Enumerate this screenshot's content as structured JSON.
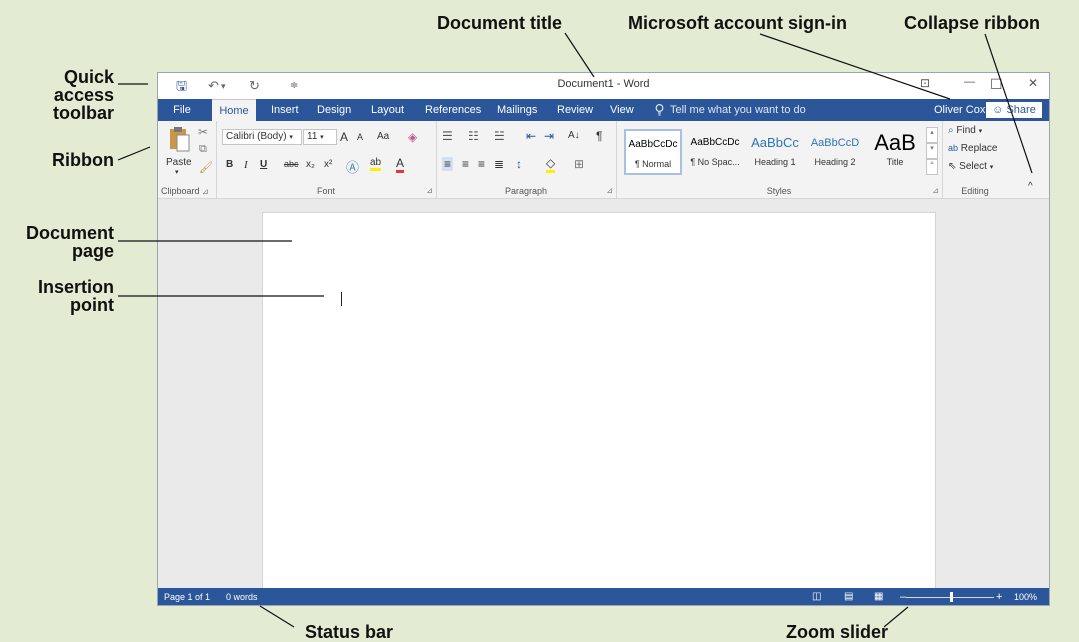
{
  "callouts": {
    "document_title": "Document title",
    "account_signin": "Microsoft account sign-in",
    "collapse_ribbon": "Collapse ribbon",
    "qat_1": "Quick",
    "qat_2": "access",
    "qat_3": "toolbar",
    "ribbon": "Ribbon",
    "doc_page_1": "Document",
    "doc_page_2": "page",
    "insertion_1": "Insertion",
    "insertion_2": "point",
    "status_bar": "Status bar",
    "zoom_slider": "Zoom slider"
  },
  "window": {
    "title": "Document1 - Word",
    "qat": {
      "save": "🖫",
      "undo": "↶",
      "undo_drop": "▾",
      "redo": "↻",
      "customize": "≑"
    },
    "controls": {
      "ribbon_options": "⊡",
      "minimize": "—",
      "maximize": "☐",
      "close": "✕"
    }
  },
  "tabs": {
    "file": "File",
    "home": "Home",
    "insert": "Insert",
    "design": "Design",
    "layout": "Layout",
    "references": "References",
    "mailings": "Mailings",
    "review": "Review",
    "view": "View",
    "tell_me": "Tell me what you want to do",
    "user": "Oliver Cox",
    "share": "Share"
  },
  "ribbon": {
    "clipboard": {
      "label": "Clipboard",
      "paste": "Paste"
    },
    "font": {
      "label": "Font",
      "name": "Calibri (Body)",
      "size": "11",
      "grow": "A",
      "shrink": "A",
      "case": "Aa",
      "bold": "B",
      "italic": "I",
      "underline": "U",
      "strike": "abc",
      "sub": "x₂",
      "sup": "x²"
    },
    "paragraph": {
      "label": "Paragraph",
      "pilcrow": "¶",
      "sort": "A↓"
    },
    "styles": {
      "label": "Styles",
      "items": [
        {
          "sample": "AaBbCcDc",
          "name": "¶ Normal"
        },
        {
          "sample": "AaBbCcDc",
          "name": "¶ No Spac..."
        },
        {
          "sample": "AaBbCc",
          "name": "Heading 1"
        },
        {
          "sample": "AaBbCcD",
          "name": "Heading 2"
        },
        {
          "sample": "AaB",
          "name": "Title"
        }
      ]
    },
    "editing": {
      "label": "Editing",
      "find": "Find",
      "replace": "Replace",
      "select": "Select"
    },
    "collapse": "^"
  },
  "status": {
    "page": "Page 1 of 1",
    "words": "0 words",
    "zoom": "100%"
  },
  "colors": {
    "ribbon_blue": "#2b579a",
    "background": "#e3ecd3"
  }
}
